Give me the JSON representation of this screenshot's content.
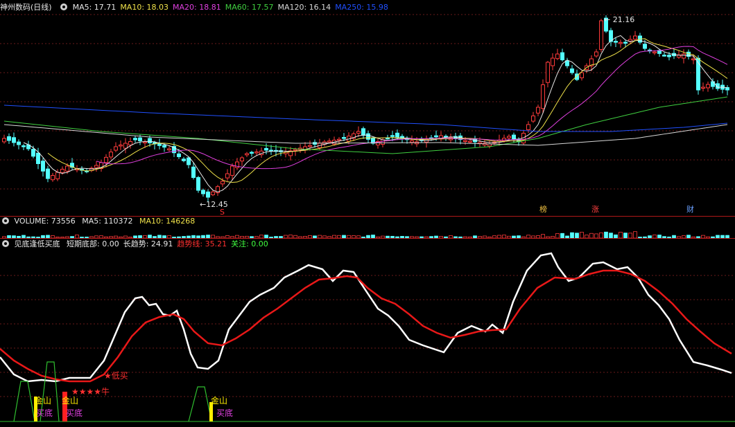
{
  "price_panel": {
    "stock_name": "神州数码",
    "period": "(日线)",
    "ma": [
      {
        "label": "MA5: 17.71",
        "color": "#e8e8e8"
      },
      {
        "label": "MA10: 18.03",
        "color": "#f0e24a"
      },
      {
        "label": "MA20: 18.81",
        "color": "#e040e0"
      },
      {
        "label": "MA60: 17.57",
        "color": "#40d040"
      },
      {
        "label": "MA120: 16.14",
        "color": "#d8d8d8"
      },
      {
        "label": "MA250: 15.98",
        "color": "#2050ff"
      }
    ],
    "high_label": "21.16",
    "low_label": "12.45",
    "markers": [
      {
        "text": "S",
        "color": "#ff3030"
      },
      {
        "text": "榜",
        "color": "#f0c040"
      },
      {
        "text": "涨",
        "color": "#ff4040"
      },
      {
        "text": "财",
        "color": "#6aa0ff"
      }
    ]
  },
  "volume_panel": {
    "label": "VOLUME: 73556",
    "ma5": "MA5: 110372",
    "ma10": "MA10: 146268"
  },
  "indicator_panel": {
    "name": "见底逢低买底",
    "items": [
      {
        "label": "短期底部: 0.00",
        "color": "#e8e8e8"
      },
      {
        "label": "长趋势: 24.91",
        "color": "#e8e8e8"
      },
      {
        "label": "趋势线: 35.21",
        "color": "#ff3030"
      },
      {
        "label": "关注: 0.00",
        "color": "#40ff40"
      }
    ],
    "signals": {
      "jinshan": "金山",
      "maidi": "买底",
      "dimai": "低买",
      "stars": "★★★★牛"
    }
  },
  "colors": {
    "up": "#ff3b3b",
    "down": "#54ffff",
    "divider": "#b01818"
  }
}
